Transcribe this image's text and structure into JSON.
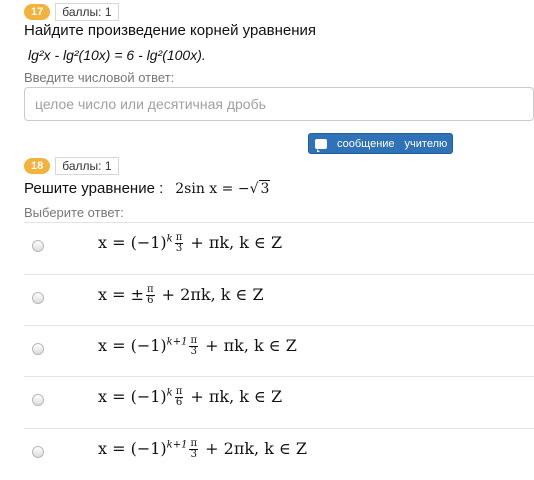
{
  "question17": {
    "badge": "17",
    "score": "баллы: 1",
    "title": "Найдите произведение корней уравнения",
    "equation": "lg²x - lg²(10x) = 6 - lg²(100x).",
    "hint": "Введите числовой ответ:",
    "input_placeholder": "целое число или десятичная дробь",
    "input_value": ""
  },
  "message_button": {
    "label1": "сообщение",
    "label2": "учителю"
  },
  "question18": {
    "badge": "18",
    "score": "баллы: 1",
    "title": "Решите уравнение :",
    "equation_lhs": "2sin x = −",
    "equation_rad": "3",
    "hint": "Выберите ответ:",
    "options": [
      {
        "prefix": "x = (−1)",
        "exp": "k",
        "num": "π",
        "den": "3",
        "suffix": "+ πk, k ∈ Z"
      },
      {
        "prefix": "x = ±",
        "exp": "",
        "num": "π",
        "den": "6",
        "suffix": "+ 2πk, k ∈ Z"
      },
      {
        "prefix": "x = (−1)",
        "exp": "k+1",
        "num": "π",
        "den": "3",
        "suffix": "+ πk, k ∈ Z"
      },
      {
        "prefix": "x = (−1)",
        "exp": "k",
        "num": "π",
        "den": "6",
        "suffix": "+ πk, k ∈ Z"
      },
      {
        "prefix": "x = (−1)",
        "exp": "k+1",
        "num": "π",
        "den": "3",
        "suffix": "+ 2πk, k ∈ Z"
      }
    ]
  }
}
